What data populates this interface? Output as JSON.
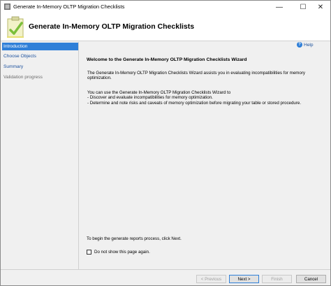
{
  "window": {
    "title": "Generate In-Memory OLTP Migration Checklists",
    "minimize": "—",
    "maximize": "☐",
    "close": "✕"
  },
  "header": {
    "title": "Generate In-Memory OLTP Migration Checklists"
  },
  "nav": {
    "items": [
      {
        "label": "Introduction",
        "state": "selected"
      },
      {
        "label": "Choose Objects",
        "state": "link"
      },
      {
        "label": "Summary",
        "state": "link"
      },
      {
        "label": "Validation progress",
        "state": "disabled"
      }
    ]
  },
  "content": {
    "help_label": "Help",
    "welcome_title": "Welcome to the Generate In-Memory OLTP Migration Checklists Wizard",
    "para1_line1": "The Generate In-Memory OLTP Migration Checklists Wizard assists you in evaluating incompatibilities for memory",
    "para1_line2": "optimization.",
    "para2_line1": "You can use the Generate In-Memory OLTP Migration Checklists Wizard to",
    "para2_line2": "- Discover and evaluate incompatibilities for memory optimization.",
    "para2_line3": "- Determine and note risks and caveats of memory optimization before migrating your table or stored procedure.",
    "begin_text": "To begin the generate reports process, click Next.",
    "checkbox_label": "Do not show this page again.",
    "checkbox_checked": false
  },
  "footer": {
    "previous": "< Previous",
    "next": "Next >",
    "finish": "Finish",
    "cancel": "Cancel"
  },
  "colors": {
    "selected_nav": "#2f7fd8",
    "link": "#1a4f9c",
    "window_bg": "#f0f0f0"
  },
  "icons": {
    "app": "wizard-app-icon",
    "header": "clipboard-check-icon",
    "help": "help-icon"
  }
}
